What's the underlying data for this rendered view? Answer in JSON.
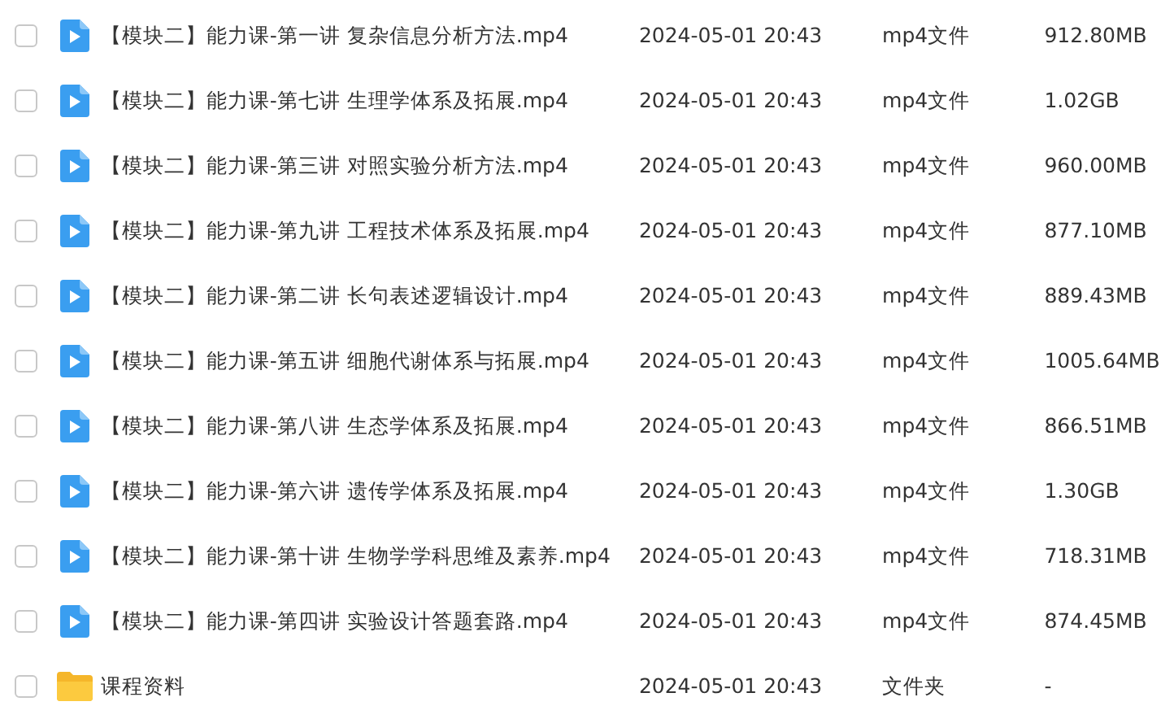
{
  "rows": [
    {
      "kind": "video",
      "checked": false,
      "name": "【模块二】能力课-第一讲 复杂信息分析方法.mp4",
      "date": "2024-05-01 20:43",
      "type": "mp4文件",
      "size": "912.80MB"
    },
    {
      "kind": "video",
      "checked": false,
      "name": "【模块二】能力课-第七讲 生理学体系及拓展.mp4",
      "date": "2024-05-01 20:43",
      "type": "mp4文件",
      "size": "1.02GB"
    },
    {
      "kind": "video",
      "checked": false,
      "name": "【模块二】能力课-第三讲 对照实验分析方法.mp4",
      "date": "2024-05-01 20:43",
      "type": "mp4文件",
      "size": "960.00MB"
    },
    {
      "kind": "video",
      "checked": false,
      "name": "【模块二】能力课-第九讲 工程技术体系及拓展.mp4",
      "date": "2024-05-01 20:43",
      "type": "mp4文件",
      "size": "877.10MB"
    },
    {
      "kind": "video",
      "checked": false,
      "name": "【模块二】能力课-第二讲 长句表述逻辑设计.mp4",
      "date": "2024-05-01 20:43",
      "type": "mp4文件",
      "size": "889.43MB"
    },
    {
      "kind": "video",
      "checked": false,
      "name": "【模块二】能力课-第五讲 细胞代谢体系与拓展.mp4",
      "date": "2024-05-01 20:43",
      "type": "mp4文件",
      "size": "1005.64MB"
    },
    {
      "kind": "video",
      "checked": false,
      "name": "【模块二】能力课-第八讲 生态学体系及拓展.mp4",
      "date": "2024-05-01 20:43",
      "type": "mp4文件",
      "size": "866.51MB"
    },
    {
      "kind": "video",
      "checked": false,
      "name": "【模块二】能力课-第六讲 遗传学体系及拓展.mp4",
      "date": "2024-05-01 20:43",
      "type": "mp4文件",
      "size": "1.30GB"
    },
    {
      "kind": "video",
      "checked": false,
      "name": "【模块二】能力课-第十讲 生物学学科思维及素养.mp4",
      "date": "2024-05-01 20:43",
      "type": "mp4文件",
      "size": "718.31MB"
    },
    {
      "kind": "video",
      "checked": false,
      "name": "【模块二】能力课-第四讲 实验设计答题套路.mp4",
      "date": "2024-05-01 20:43",
      "type": "mp4文件",
      "size": "874.45MB"
    },
    {
      "kind": "folder",
      "checked": false,
      "name": "课程资料",
      "date": "2024-05-01 20:43",
      "type": "文件夹",
      "size": "-"
    }
  ]
}
